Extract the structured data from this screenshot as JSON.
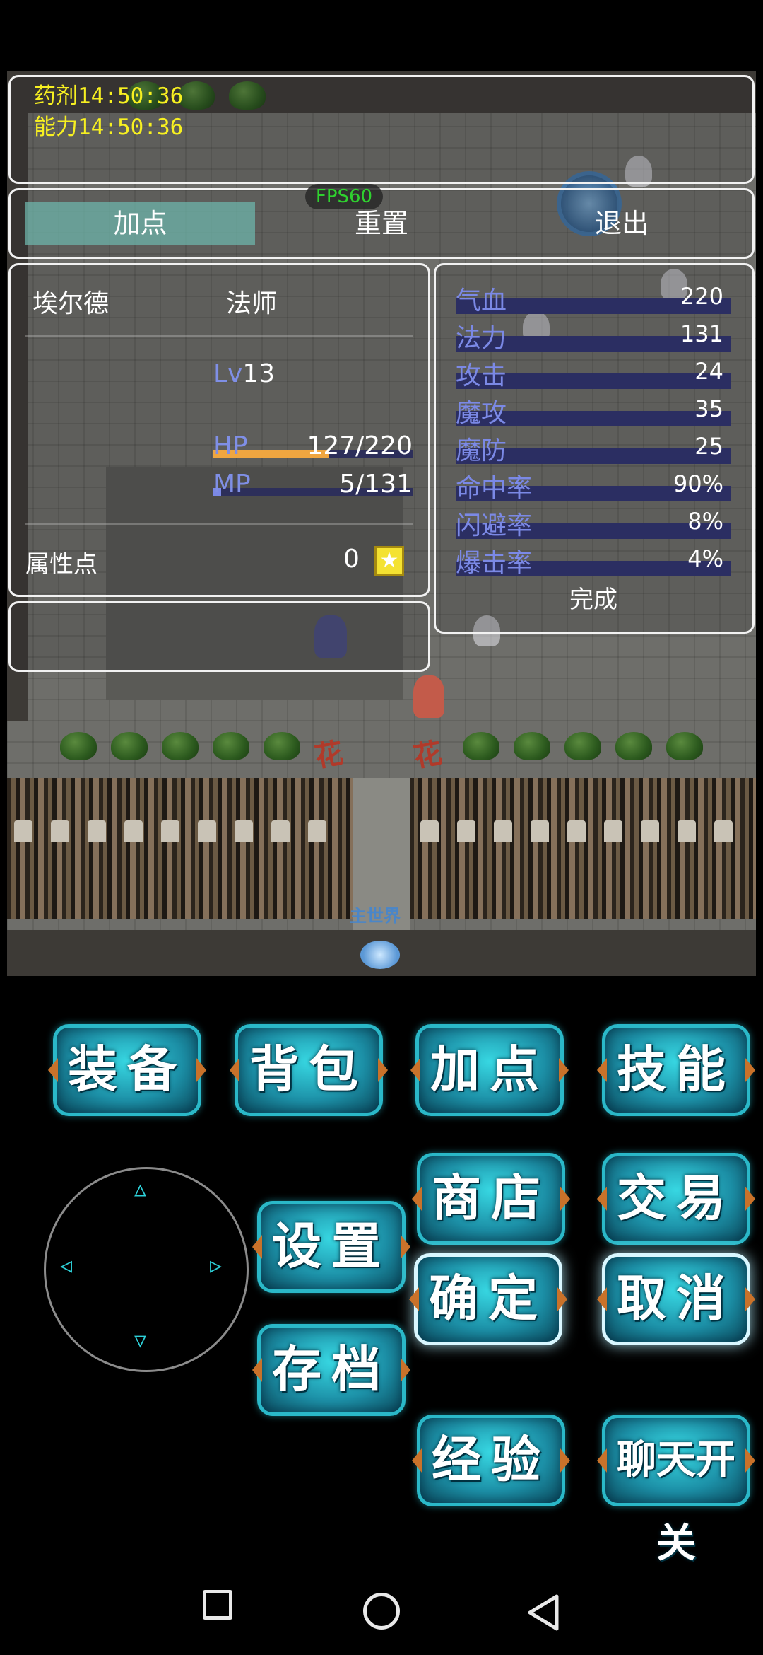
{
  "timers": {
    "potion": "药剂14:50:36",
    "ability": "能力14:50:36"
  },
  "fps": "FPS60",
  "commands": {
    "add_points": "加点",
    "reset": "重置",
    "exit": "退出"
  },
  "character": {
    "name": "埃尔德",
    "class": "法师",
    "level_label": "Lv",
    "level": "13",
    "hp_label": "HP",
    "hp_value": "127/220",
    "hp_fraction": 0.577,
    "mp_label": "MP",
    "mp_value": "5/131",
    "mp_fraction": 0.038,
    "attr_points_label": "属性点",
    "attr_points": "0"
  },
  "stats": [
    {
      "name": "气血",
      "value": "220"
    },
    {
      "name": "法力",
      "value": "131"
    },
    {
      "name": "攻击",
      "value": "24"
    },
    {
      "name": "魔攻",
      "value": "35"
    },
    {
      "name": "魔防",
      "value": "25"
    },
    {
      "name": "命中率",
      "value": "90%"
    },
    {
      "name": "闪避率",
      "value": "8%"
    },
    {
      "name": "爆击率",
      "value": "4%"
    }
  ],
  "done_label": "完成",
  "scene": {
    "sign_left": "花",
    "sign_right": "花",
    "portal_label": "主世界"
  },
  "buttons": {
    "equip": "装备",
    "bag": "背包",
    "add_points": "加点",
    "skills": "技能",
    "shop": "商店",
    "trade": "交易",
    "settings": "设置",
    "confirm": "确定",
    "cancel": "取消",
    "save": "存档",
    "exp": "经验",
    "chat_toggle": "聊天开关"
  },
  "icons": {
    "joystick_up": "▵",
    "joystick_down": "▿",
    "joystick_left": "◃",
    "joystick_right": "▹",
    "star": "★"
  },
  "colors": {
    "hp_bar": "#f0a640",
    "mp_bar": "#3c3f8c",
    "timer_text": "#f7f021",
    "fps_text": "#2fd12f",
    "button_accent": "#2ab8c8"
  }
}
